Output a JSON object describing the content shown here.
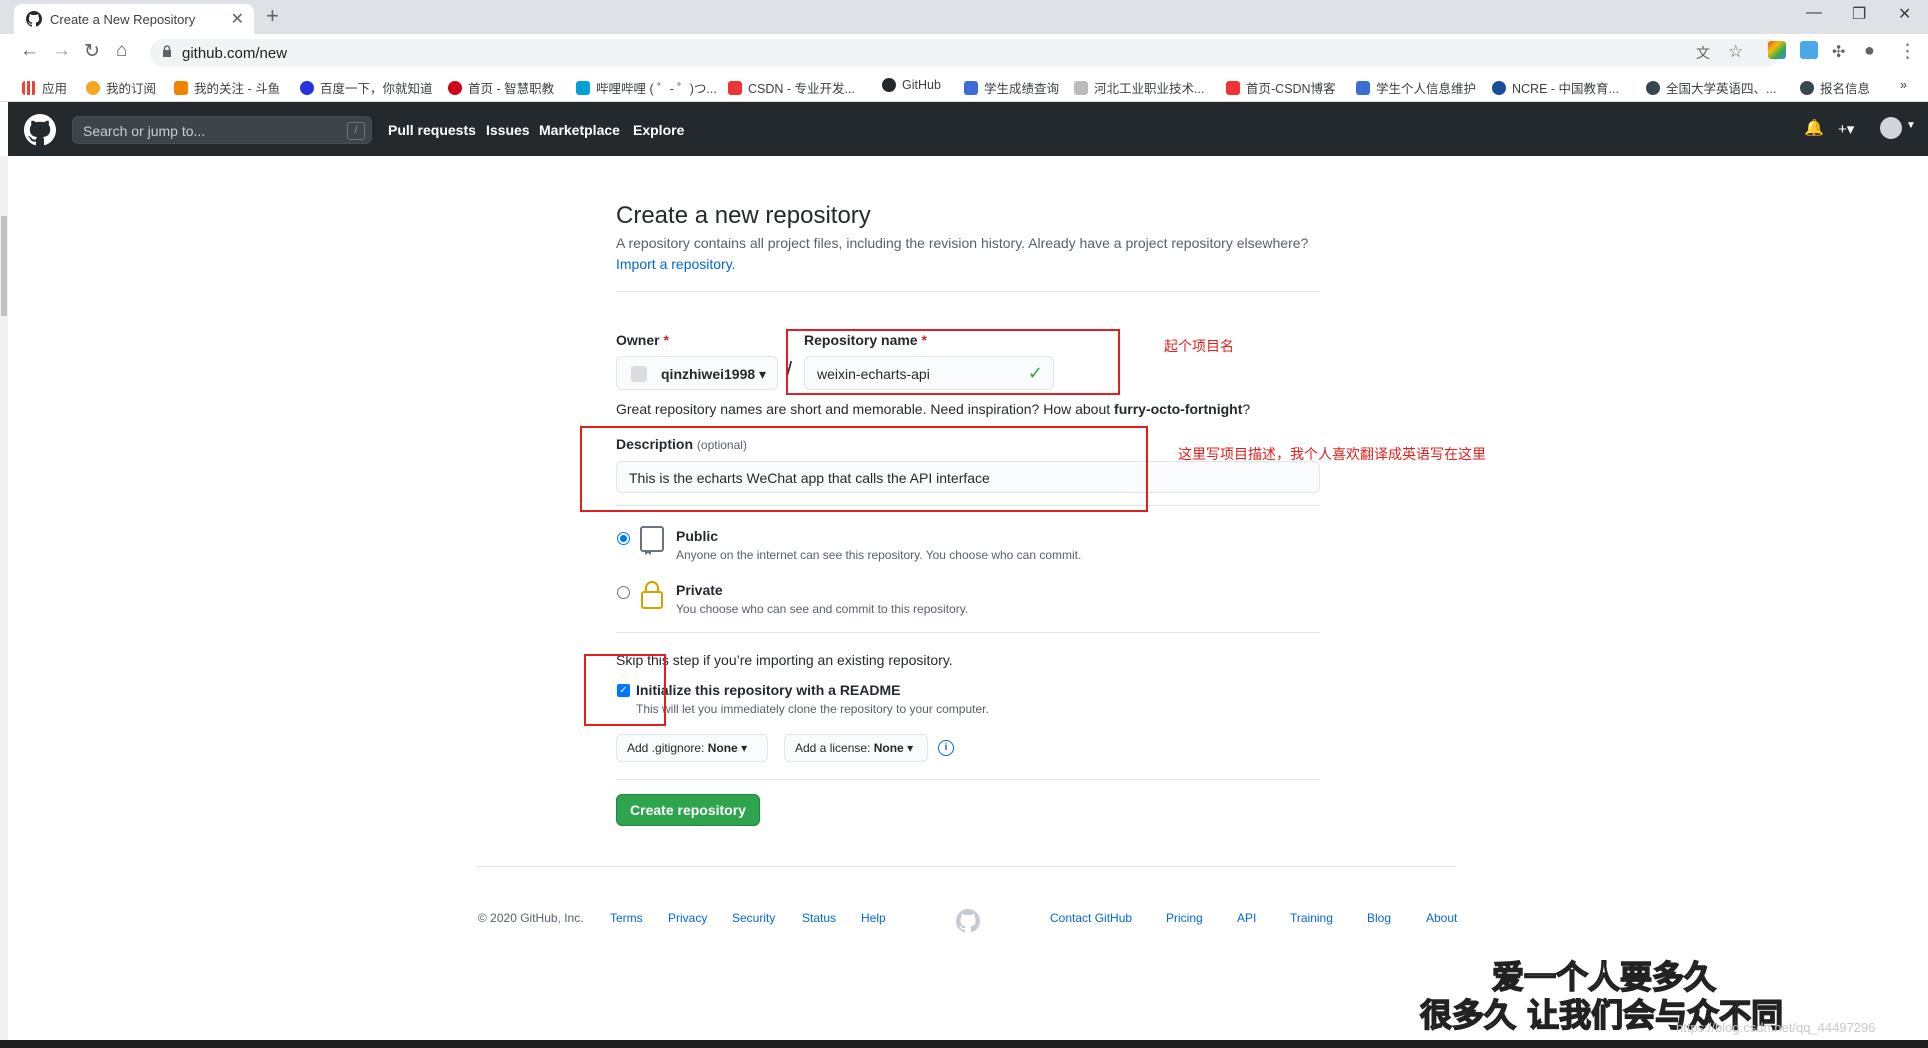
{
  "browser": {
    "tab_title": "Create a New Repository",
    "url": "github.com/new",
    "bookmarks": [
      "应用",
      "我的订阅",
      "我的关注 - 斗鱼",
      "百度一下，你就知道",
      "首页 - 智慧职教",
      "哔哩哔哩 ( ゜- ゜)つ...",
      "CSDN - 专业开发...",
      "GitHub",
      "学生成绩查询",
      "河北工业职业技术...",
      "首页-CSDN博客",
      "学生个人信息维护",
      "NCRE - 中国教育...",
      "全国大学英语四、...",
      "报名信息"
    ]
  },
  "gh_header": {
    "search_placeholder": "Search or jump to...",
    "search_key": "/",
    "nav": [
      "Pull requests",
      "Issues",
      "Marketplace",
      "Explore"
    ],
    "plus": "+▾"
  },
  "page": {
    "title": "Create a new repository",
    "subtitle": "A repository contains all project files, including the revision history. Already have a project repository elsewhere?",
    "import_link": "Import a repository.",
    "owner_label": "Owner",
    "required_mark": "*",
    "owner_value": "qinzhiwei1998 ▾",
    "separator": "/",
    "repo_label": "Repository name",
    "repo_value": "weixin-echarts-api",
    "name_hint_prefix": "Great repository names are short and memorable. Need inspiration? How about ",
    "name_hint_suggestion": "furry-octo-fortnight",
    "name_hint_suffix": "?",
    "description_label": "Description",
    "description_optional": "(optional)",
    "description_value": "This is the echarts WeChat app that calls the API interface",
    "public_title": "Public",
    "public_desc": "Anyone on the internet can see this repository. You choose who can commit.",
    "private_title": "Private",
    "private_desc": "You choose who can see and commit to this repository.",
    "skip_note": "Skip this step if you’re importing an existing repository.",
    "readme_title": "Initialize this repository with a README",
    "readme_desc": "This will let you immediately clone the repository to your computer.",
    "gitignore_prefix": "Add .gitignore:",
    "gitignore_value": "None ▾",
    "license_prefix": "Add a license:",
    "license_value": "None ▾",
    "info_glyph": "i",
    "create_button": "Create repository"
  },
  "annotations": {
    "name_note": "起个项目名",
    "desc_note": "这里写项目描述，我个人喜欢翻译成英语写在这里"
  },
  "footer": {
    "copyright": "© 2020 GitHub, Inc.",
    "left_links": [
      "Terms",
      "Privacy",
      "Security",
      "Status",
      "Help"
    ],
    "right_links": [
      "Contact GitHub",
      "Pricing",
      "API",
      "Training",
      "Blog",
      "About"
    ]
  },
  "watermark": {
    "line1": "爱一个人要多久",
    "line2": "很多久  让我们会与众不同",
    "url": "https://blog.csdn.net/qq_44497296"
  },
  "colors": {
    "accent_link": "#0366d6",
    "create_green": "#2ea44f",
    "header_bg": "#24292e",
    "annotation_red": "#e02020"
  }
}
